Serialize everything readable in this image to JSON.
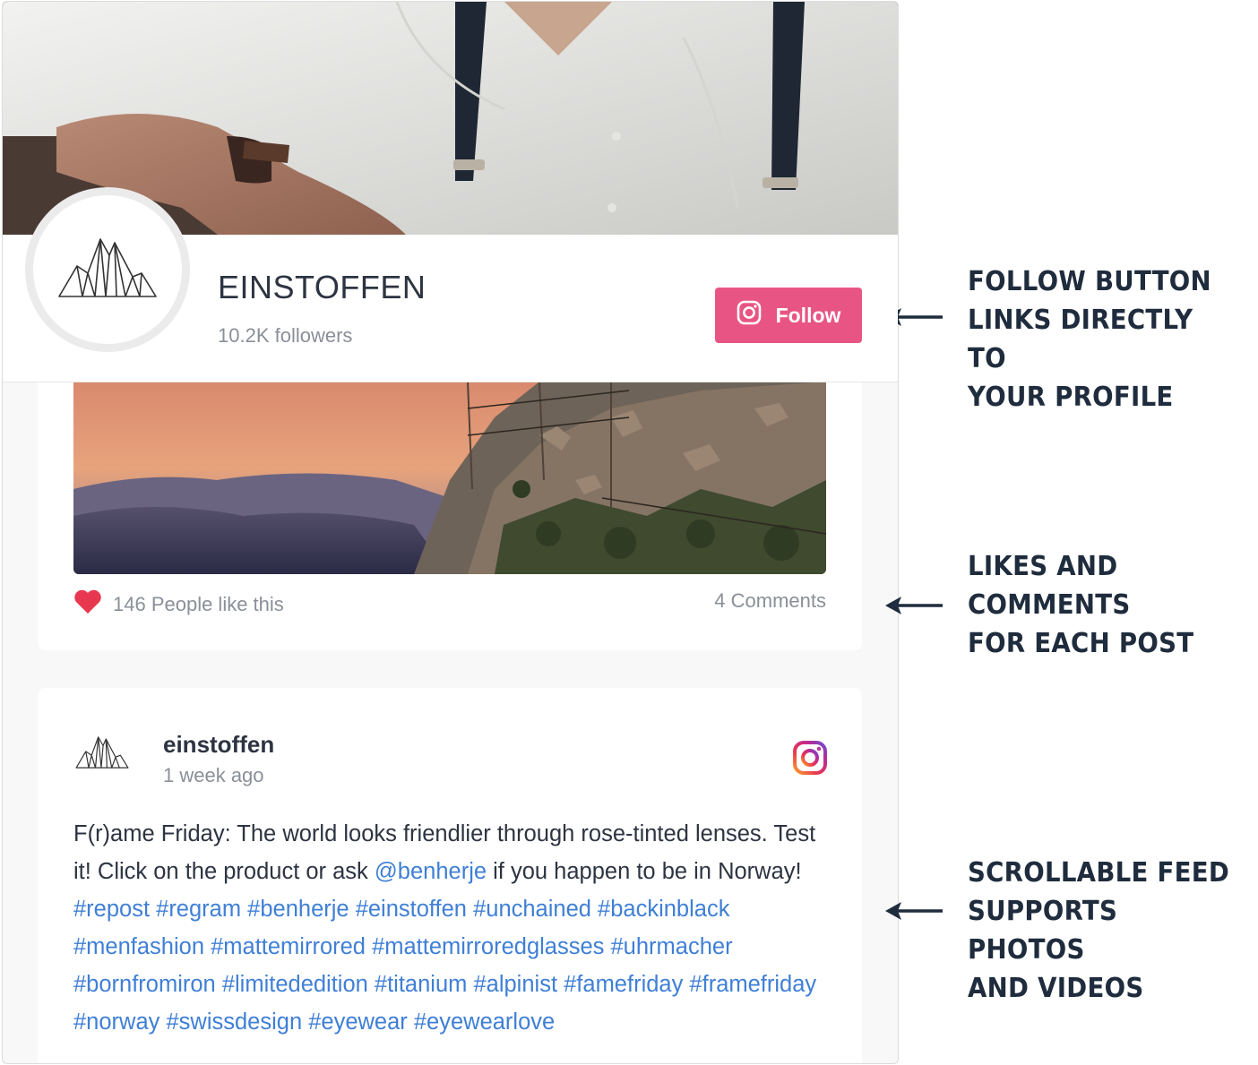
{
  "profile": {
    "name": "EINSTOFFEN",
    "followers": "10.2K followers",
    "follow_label": "Follow"
  },
  "post1": {
    "likes": "146 People like this",
    "comments": "4 Comments"
  },
  "post2": {
    "username": "einstoffen",
    "time": "1 week ago",
    "caption_parts": [
      {
        "text": "F(r)ame Friday: The world looks friendlier through rose-tinted lenses. Test it! Click on the product or ask ",
        "link": false
      },
      {
        "text": "@benherje",
        "link": true
      },
      {
        "text": " if you happen to be in Norway! ",
        "link": false
      },
      {
        "text": "#repost #regram #benherje #einstoffen #unchained #backinblack #menfashion #mattemirrored #mattemirroredglasses #uhrmacher #bornfromiron #limitededition #titanium #alpinist #famefriday #framefriday #norway #swissdesign #eyewear #eyewearlove",
        "link": true
      }
    ]
  },
  "annotations": {
    "follow": [
      "FOLLOW BUTTON",
      "LINKS DIRECTLY TO",
      "YOUR PROFILE"
    ],
    "likes": [
      "LIKES AND",
      "COMMENTS",
      "FOR EACH POST"
    ],
    "feed": [
      "SCROLLABLE FEED",
      "SUPPORTS PHOTOS",
      "AND VIDEOS"
    ]
  },
  "colors": {
    "follow_button": "#e85585",
    "link": "#3f7fd6",
    "heart": "#e8384f",
    "annotation_text": "#1f2c3d"
  },
  "icons": [
    "mountain-logo-icon",
    "instagram-icon",
    "heart-icon",
    "arrow-left-icon"
  ]
}
